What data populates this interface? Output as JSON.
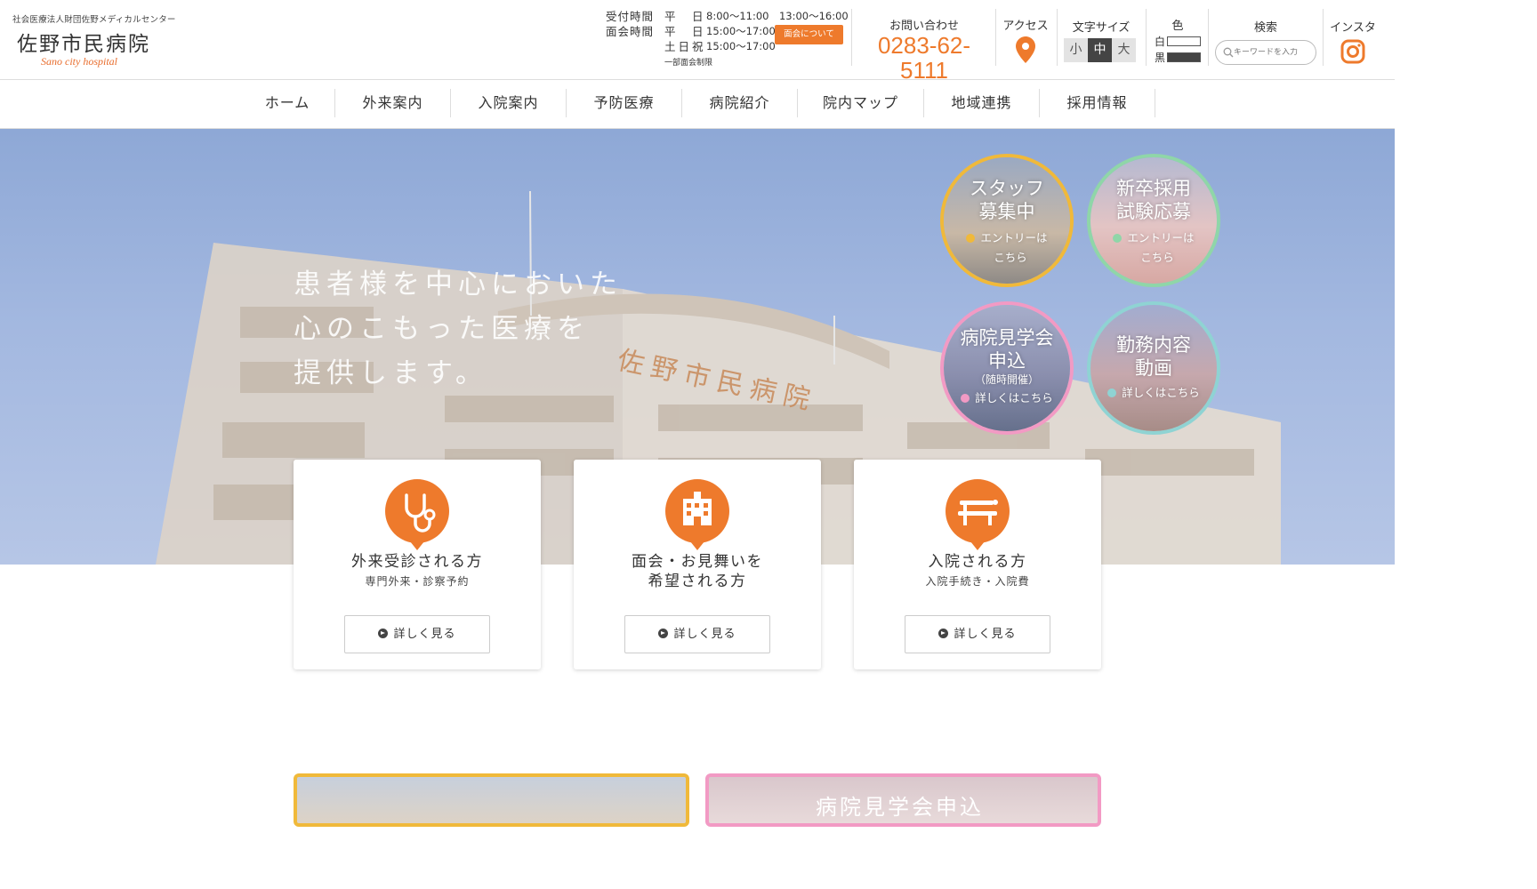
{
  "header": {
    "org_name": "社会医療法人財団佐野メディカルセンター",
    "hospital_name": "佐野市民病院",
    "hospital_name_en": "Sano city hospital",
    "hours": [
      {
        "label": "受付時間",
        "day": "平　日",
        "time": "8:00〜11:00　13:00〜16:00"
      },
      {
        "label": "面会時間",
        "day": "平　日",
        "time": "15:00〜17:00"
      },
      {
        "label": "",
        "day": "土日祝",
        "time": "15:00〜17:00"
      }
    ],
    "hours_note": "一部面会制限",
    "visit_button": "面会について",
    "contact_label": "お問い合わせ",
    "phone": "0283-62-5111",
    "access_label": "アクセス",
    "fontsize_label": "文字サイズ",
    "fontsize_options": [
      "小",
      "中",
      "大"
    ],
    "fontsize_selected": "中",
    "color_label": "色",
    "color_white": "白",
    "color_black": "黒",
    "search_label": "検索",
    "search_placeholder": "キーワードを入力",
    "insta_label": "インスタ"
  },
  "nav": [
    "ホーム",
    "外来案内",
    "入院案内",
    "予防医療",
    "病院紹介",
    "院内マップ",
    "地域連携",
    "採用情報"
  ],
  "hero": {
    "catch_lines": [
      "患者様を中心においた",
      "心のこもった医療を",
      "提供します。"
    ],
    "building_sign": "佐野市民病院",
    "circles": [
      {
        "title_lines": [
          "スタッフ",
          "募集中"
        ],
        "note": "",
        "link_lines": [
          "エントリーは",
          "こちら"
        ],
        "border": "#f0b93a",
        "dot": "#f0b93a"
      },
      {
        "title_lines": [
          "新卒採用",
          "試験応募"
        ],
        "note": "",
        "link_lines": [
          "エントリーは",
          "こちら"
        ],
        "border": "#8fd6a8",
        "dot": "#8fd6a8"
      },
      {
        "title_lines": [
          "病院見学会",
          "申込"
        ],
        "note": "（随時開催）",
        "link_lines": [
          "詳しくはこちら"
        ],
        "border": "#f29ac4",
        "dot": "#f29ac4"
      },
      {
        "title_lines": [
          "勤務内容",
          "動画"
        ],
        "note": "",
        "link_lines": [
          "詳しくはこちら"
        ],
        "border": "#8fd3d3",
        "dot": "#8fd3d3"
      }
    ]
  },
  "cards": [
    {
      "icon": "stethoscope-icon",
      "title_lines": [
        "外来受診される方"
      ],
      "sub": "専門外来・診察予約",
      "button": "詳しく見る"
    },
    {
      "icon": "hospital-building-icon",
      "title_lines": [
        "面会・お見舞いを",
        "希望される方"
      ],
      "sub": "",
      "button": "詳しく見る"
    },
    {
      "icon": "stretcher-bed-icon",
      "title_lines": [
        "入院される方"
      ],
      "sub": "入院手続き・入院費",
      "button": "詳しく見る"
    }
  ],
  "banners": [
    {
      "text": "",
      "border": "#f0b93a"
    },
    {
      "text": "病院見学会申込",
      "border": "#f29ac4"
    }
  ],
  "colors": {
    "accent": "#ee7a2c",
    "text": "#333333"
  }
}
